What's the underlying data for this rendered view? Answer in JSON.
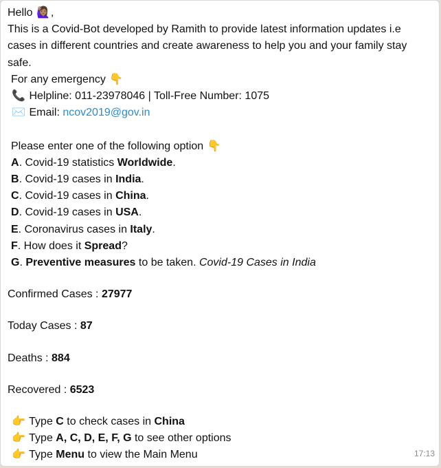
{
  "message": {
    "greeting": "Hello",
    "greeting_emoji": "🙋🏽‍♀️",
    "greeting_comma": ",",
    "intro": "This is a Covid-Bot developed by Ramith to provide latest information updates i.e cases in different countries and create awareness to help you and your family stay safe.",
    "emergency": "For any emergency",
    "emergency_emoji": "👇",
    "helpline_emoji": "📞",
    "helpline": "Helpline: 011-23978046 | Toll-Free Number: 1075",
    "email_emoji": "✉️",
    "email_label": "Email:",
    "email": "ncov2019@gov.in",
    "options_prompt": "Please enter one of the following option",
    "options_emoji": "👇",
    "options": [
      {
        "key": "A",
        "pre": ". Covid-19 statistics ",
        "bold": "Worldwide",
        "post": "."
      },
      {
        "key": "B",
        "pre": ". Covid-19 cases in ",
        "bold": "India",
        "post": "."
      },
      {
        "key": "C",
        "pre": ". Covid-19 cases in ",
        "bold": "China",
        "post": "."
      },
      {
        "key": "D",
        "pre": ". Covid-19 cases in ",
        "bold": "USA",
        "post": "."
      },
      {
        "key": "E",
        "pre": ". Coronavirus cases in ",
        "bold": "Italy",
        "post": "."
      },
      {
        "key": "F",
        "pre": ". How does it ",
        "bold": "Spread",
        "post": "?"
      },
      {
        "key": "G",
        "pre": ". ",
        "bold": "Preventive measures",
        "post": " to be taken. "
      }
    ],
    "india_title": "Covid-19 Cases in India",
    "stats": [
      {
        "label": "Confirmed Cases : ",
        "value": "27977"
      },
      {
        "label": "Today Cases : ",
        "value": "87"
      },
      {
        "label": "Deaths : ",
        "value": "884"
      },
      {
        "label": "Recovered : ",
        "value": "6523"
      }
    ],
    "hint_emoji": "👉",
    "hint1": {
      "pre": " Type ",
      "bold1": "C",
      "mid": " to check cases in ",
      "bold2": "China"
    },
    "hint2": {
      "pre": " Type ",
      "bold1": "A, C, D, E, F, G",
      "mid": " to see other options"
    },
    "hint3": {
      "pre": " Type ",
      "bold1": "Menu",
      "mid": " to view the Main Menu"
    },
    "time": "17:13"
  },
  "colors": {
    "link": "#2a8bd5",
    "bubble": "#ffffff",
    "timestamp": "#8a8a8a"
  }
}
